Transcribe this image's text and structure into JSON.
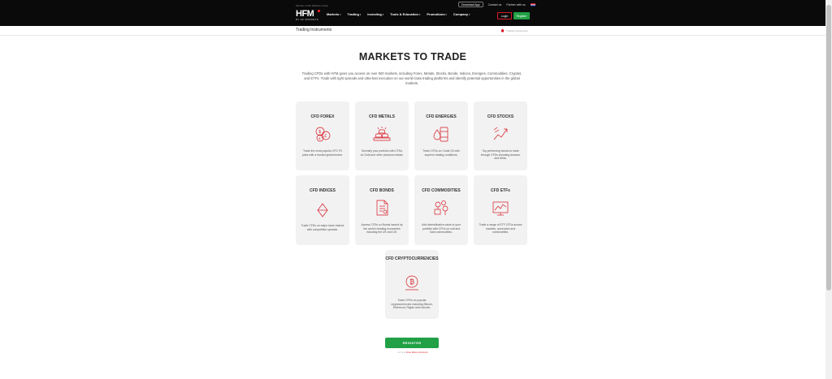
{
  "header": {
    "logo_tagline": "Member of HF Markets Group",
    "logo_text": "HFM",
    "logo_sub": "BY HF MARKETS",
    "nav": [
      "Markets",
      "Trading",
      "Investing",
      "Tools & Education",
      "Promotions",
      "Company"
    ],
    "download_app": "Download App",
    "contact": "Contact us",
    "partner": "Partner with us",
    "login": "Login",
    "register": "Register"
  },
  "subbar": {
    "title": "Trading Instruments",
    "breadcrumb": "Trading Instruments"
  },
  "main": {
    "title": "MARKETS TO TRADE",
    "intro": "Trading CFDs with HFM gives you access on over 500 markets, including Forex, Metals, Stocks, Bonds, Indices, Energies, Commodities, Cryptos, and ETFs. Trade with tight spreads and ultra-fast execution on our world-class trading platforms and identify potential opportunities in the global markets.",
    "cards": [
      {
        "title": "CFD FOREX",
        "icon": "currency-coins-icon",
        "desc": "Trade the most popular CFD FX pairs with a trusted global broker."
      },
      {
        "title": "CFD METALS",
        "icon": "gold-bars-icon",
        "desc": "Diversify your portfolio with CFDs on Gold and other precious metals."
      },
      {
        "title": "CFD ENERGIES",
        "icon": "oil-barrel-icon",
        "desc": "Trade CFDs on Crude Oil with superior trading conditions."
      },
      {
        "title": "CFD STOCKS",
        "icon": "stocks-chart-icon",
        "desc": "Top performing stocks to trade through CFDs including Amazon and Meta."
      },
      {
        "title": "CFD INDICES",
        "icon": "indices-diamond-icon",
        "desc": "Trade CFDs on major stock indices with competitive spreads."
      },
      {
        "title": "CFD BONDS",
        "icon": "bond-document-icon",
        "desc": "Access CFDs on Bonds issued by the world's leading economies including the UK and US."
      },
      {
        "title": "CFD COMMODITIES",
        "icon": "commodities-icon",
        "desc": "Add diversification value to your portfolio with CFDs on soft and hard commodities."
      },
      {
        "title": "CFD ETFs",
        "icon": "etf-chart-icon",
        "desc": "Trade a range of ETF CFDs across markets, currencies and commodities."
      },
      {
        "title": "CFD CRYPTOCURRENCIES",
        "icon": "bitcoin-icon",
        "desc": "Trade CFDs on popular cryptocurrencies including Bitcoin, Ethereum, Ripple and Litecoin."
      }
    ],
    "register_button": "REGISTER",
    "risk_prefix": "or try a",
    "risk_link": "Free Demo Account"
  },
  "colors": {
    "accent_red": "#d71920",
    "accent_green": "#21a045",
    "header_bg": "#0a0a0a",
    "card_bg": "#f2f2f3"
  }
}
